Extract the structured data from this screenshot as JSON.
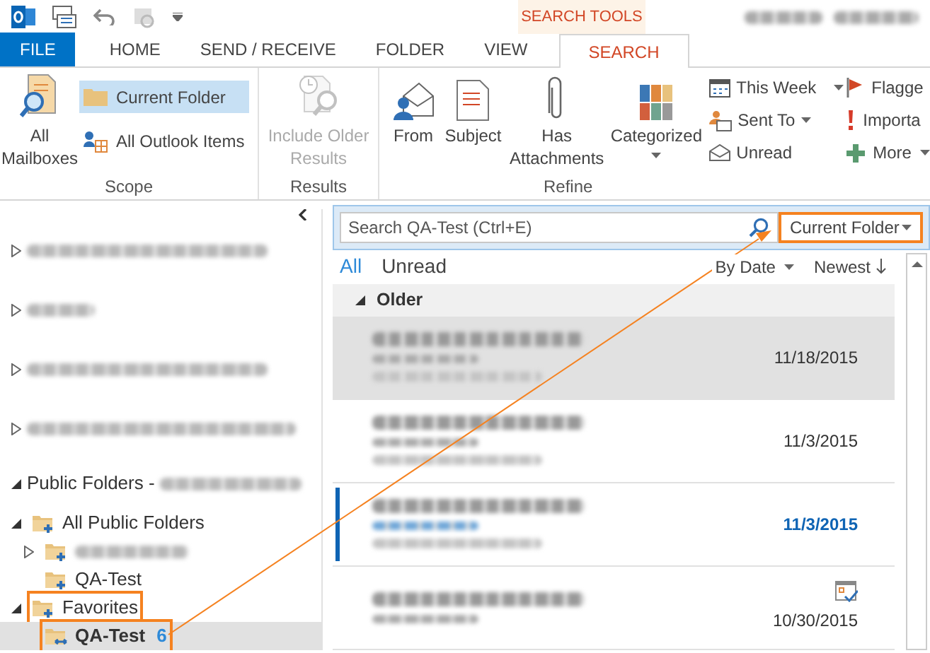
{
  "title_bar": {
    "contextual_tab": "SEARCH TOOLS"
  },
  "tabs": [
    {
      "label": "FILE",
      "kind": "file",
      "selected": false
    },
    {
      "label": "HOME",
      "kind": "normal",
      "selected": false
    },
    {
      "label": "SEND / RECEIVE",
      "kind": "normal",
      "selected": false
    },
    {
      "label": "FOLDER",
      "kind": "normal",
      "selected": false
    },
    {
      "label": "VIEW",
      "kind": "normal",
      "selected": false
    },
    {
      "label": "SEARCH",
      "kind": "contextual",
      "selected": true
    }
  ],
  "ribbon": {
    "scope": {
      "label": "Scope",
      "all_mailboxes": "All Mailboxes",
      "options": [
        {
          "label": "Current Folder",
          "selected": true
        },
        {
          "label": "All Outlook Items",
          "selected": false
        }
      ]
    },
    "results": {
      "label": "Results",
      "include_older": {
        "label": "Include Older Results",
        "disabled": true
      }
    },
    "refine": {
      "label": "Refine",
      "large_buttons": [
        {
          "label": "From",
          "dropdown": false
        },
        {
          "label": "Subject",
          "dropdown": false
        },
        {
          "label": "Has Attachments",
          "dropdown": false
        },
        {
          "label": "Categorized",
          "dropdown": true
        }
      ],
      "small_buttons": [
        {
          "label": "This Week",
          "dropdown": true
        },
        {
          "label": "Sent To",
          "dropdown": true
        },
        {
          "label": "Unread",
          "dropdown": false
        },
        {
          "label": "Flagge",
          "dropdown": false
        },
        {
          "label": "Importa",
          "dropdown": false
        },
        {
          "label": "More",
          "dropdown": true
        }
      ]
    }
  },
  "folder_pane": {
    "tree": [
      {
        "kind": "account",
        "leaf": false,
        "expanded": false
      },
      {
        "kind": "account",
        "leaf": false,
        "expanded": false
      },
      {
        "kind": "account",
        "leaf": false,
        "expanded": false
      },
      {
        "kind": "account",
        "leaf": false,
        "expanded": false
      },
      {
        "kind": "root",
        "label": "Public Folders -",
        "redacted_suffix": true,
        "leaf": false,
        "expanded": true,
        "children": [
          {
            "kind": "folder",
            "label": "All Public Folders",
            "leaf": false,
            "expanded": true,
            "highlighted": false,
            "children": [
              {
                "kind": "folder",
                "redacted": true,
                "leaf": false,
                "expanded": false,
                "highlighted": false
              },
              {
                "kind": "folder",
                "label": "QA-Test",
                "leaf": true,
                "highlighted": false
              }
            ]
          },
          {
            "kind": "folder",
            "label": "Favorites",
            "leaf": false,
            "expanded": true,
            "highlighted": true,
            "children": [
              {
                "kind": "favorite",
                "label": "QA-Test",
                "count": "6",
                "leaf": true,
                "selected": true,
                "highlighted": true
              }
            ]
          }
        ]
      }
    ]
  },
  "search": {
    "placeholder": "Search QA-Test (Ctrl+E)",
    "scope": "Current Folder",
    "highlighted": true
  },
  "filters": [
    {
      "label": "All",
      "selected": true
    },
    {
      "label": "Unread",
      "selected": false
    }
  ],
  "sort": {
    "by": "By Date",
    "order": "Newest"
  },
  "message_group": {
    "label": "Older",
    "expanded": true
  },
  "messages": [
    {
      "date": "11/18/2015",
      "selected": true,
      "unread": false,
      "kind": "mail"
    },
    {
      "date": "11/3/2015",
      "selected": false,
      "unread": false,
      "kind": "mail"
    },
    {
      "date": "11/3/2015",
      "selected": false,
      "unread": true,
      "kind": "mail"
    },
    {
      "date": "10/30/2015",
      "selected": false,
      "unread": false,
      "kind": "meeting"
    }
  ]
}
